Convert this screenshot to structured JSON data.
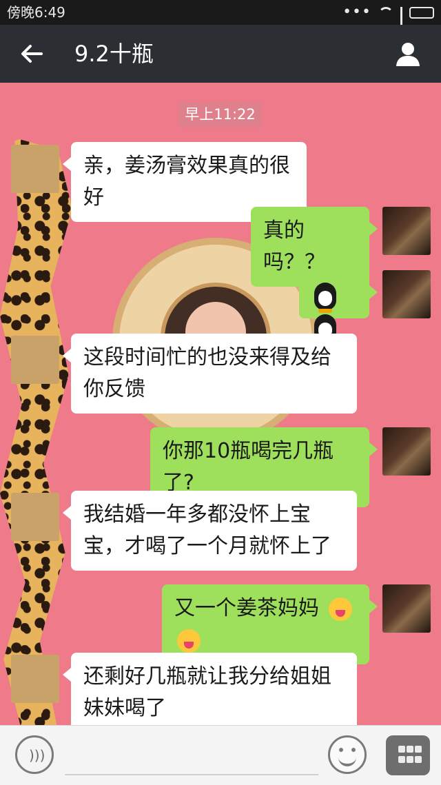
{
  "status_bar": {
    "time": "傍晚6:49",
    "dots": "•••"
  },
  "header": {
    "title": "9.2十瓶"
  },
  "chat": {
    "timestamp": "早上11:22",
    "messages": [
      {
        "side": "left",
        "text": "亲，姜汤膏效果真的很好"
      },
      {
        "side": "right",
        "text": "真的吗？？"
      },
      {
        "side": "right",
        "text": "",
        "emoji": [
          "penguin-emoji",
          "penguin-emoji"
        ]
      },
      {
        "side": "left",
        "text": "这段时间忙的也没来得及给你反馈"
      },
      {
        "side": "right",
        "text": "你那10瓶喝完几瓶了?"
      },
      {
        "side": "left",
        "text": "我结婚一年多都没怀上宝宝，才喝了一个月就怀上了"
      },
      {
        "side": "right",
        "text": "又一个姜茶妈妈"
      },
      {
        "side": "left",
        "text": "还剩好几瓶就让我分给姐姐妹妹喝了"
      }
    ]
  },
  "icons": {
    "back": "arrow-left-icon",
    "profile": "person-icon",
    "voice": "voice-icon",
    "emoji": "emoji-icon",
    "more": "grid-icon"
  },
  "colors": {
    "chat_background": "#ee7a8a",
    "outgoing_bubble": "#9ee05c",
    "incoming_bubble": "#ffffff",
    "nav_bar": "#2b2e33"
  }
}
